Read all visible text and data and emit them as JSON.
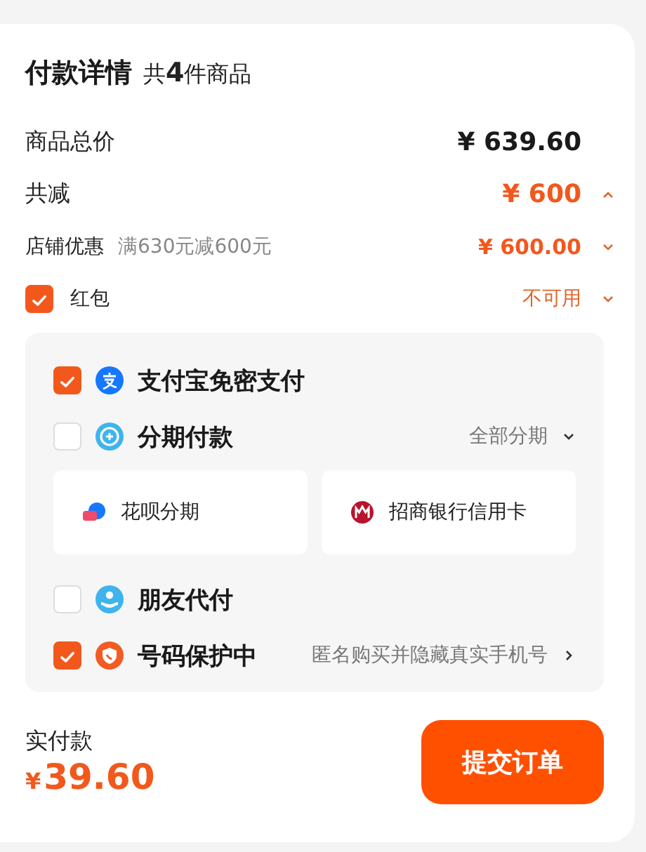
{
  "title": "付款详情",
  "item_count": "共**4**件商品",
  "summary": [
    {
      "kind": "total",
      "label": "商品总价",
      "value": "¥ 639.60"
    },
    {
      "kind": "discount",
      "label": "共减",
      "value": "¥ 600",
      "expanded": true
    },
    {
      "kind": "store",
      "label": "店铺优惠",
      "note": "满630元减600元",
      "value": "¥ 600.00",
      "expanded": false
    },
    {
      "kind": "redpacket",
      "label": "红包",
      "checked": true,
      "value": "不可用",
      "expanded": false
    }
  ],
  "payment_options": [
    {
      "kind": "alipay",
      "label": "支付宝免密支付",
      "checked": true
    },
    {
      "kind": "installment",
      "label": "分期付款",
      "checked": false,
      "action": {
        "kind": "dropdown",
        "text": "全部分期"
      },
      "plans": [
        {
          "kind": "huabei",
          "label": "花呗分期"
        },
        {
          "kind": "bank",
          "label": "招商银行信用卡"
        }
      ]
    },
    {
      "kind": "friend",
      "label": "朋友代付",
      "checked": false
    },
    {
      "kind": "privacy",
      "label": "号码保护中",
      "checked": true,
      "action": {
        "kind": "link",
        "text": "匿名购买并隐藏真实手机号"
      }
    }
  ],
  "footer": {
    "label": "实付款",
    "currency": "¥",
    "amount": "39.60",
    "submit": "提交订单"
  }
}
